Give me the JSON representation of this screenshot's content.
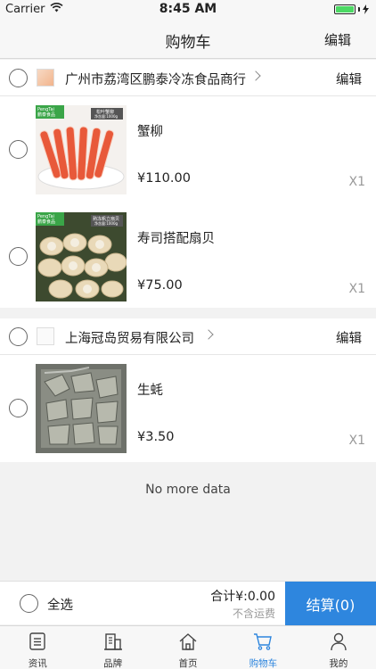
{
  "status_bar": {
    "carrier": "Carrier",
    "time": "8:45 AM"
  },
  "nav": {
    "title": "购物车",
    "edit_label": "编辑"
  },
  "stores": [
    {
      "name": "广州市荔湾区鹏泰冷冻食品商行",
      "edit_label": "编辑",
      "items": [
        {
          "name": "蟹柳",
          "price": "¥110.00",
          "qty": "X1",
          "thumb_brand": "PengTai\n鹏泰食品",
          "thumb_tag": "松叶蟹柳"
        },
        {
          "name": "寿司搭配扇贝",
          "price": "¥75.00",
          "qty": "X1",
          "thumb_brand": "PengTai\n鹏泰食品",
          "thumb_tag": "熟冻帆立扇贝"
        }
      ]
    },
    {
      "name": "上海冠岛贸易有限公司",
      "edit_label": "编辑",
      "items": [
        {
          "name": "生蚝",
          "price": "¥3.50",
          "qty": "X1"
        }
      ]
    }
  ],
  "list_footer": "No more data",
  "checkout": {
    "select_all": "全选",
    "total": "合计¥:0.00",
    "shipping_note": "不含运费",
    "button": "结算(0)"
  },
  "tabs": [
    {
      "label": "资讯",
      "icon": "news-icon"
    },
    {
      "label": "品牌",
      "icon": "building-icon"
    },
    {
      "label": "首页",
      "icon": "home-icon"
    },
    {
      "label": "购物车",
      "icon": "cart-icon",
      "active": true
    },
    {
      "label": "我的",
      "icon": "person-icon"
    }
  ],
  "colors": {
    "accent": "#2e86de",
    "battery": "#4cd964"
  }
}
